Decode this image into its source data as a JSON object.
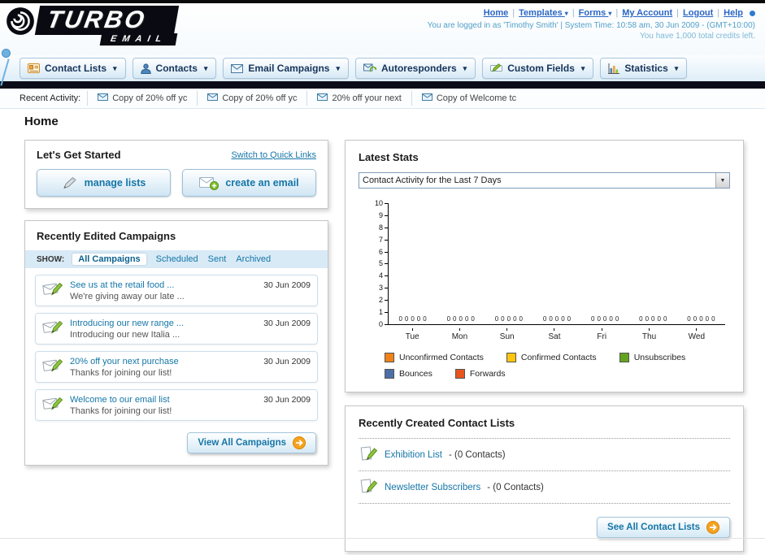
{
  "header": {
    "logo": {
      "line1": "TURBO",
      "line2": "EMAIL"
    },
    "nav_links": [
      {
        "label": "Home",
        "dropdown": false
      },
      {
        "label": "Templates",
        "dropdown": true
      },
      {
        "label": "Forms",
        "dropdown": true
      },
      {
        "label": "My Account",
        "dropdown": false
      },
      {
        "label": "Logout",
        "dropdown": false
      },
      {
        "label": "Help",
        "dropdown": false
      }
    ],
    "login_info": "You are logged in as 'Timothy Smith' | System Time: 10:58 am, 30 Jun 2009 - (GMT+10:00)",
    "credits_info": "You have 1,000 total credits left."
  },
  "main_nav": {
    "tabs": [
      {
        "label": "Contact Lists",
        "icon": "contact-lists-icon"
      },
      {
        "label": "Contacts",
        "icon": "contacts-icon"
      },
      {
        "label": "Email Campaigns",
        "icon": "email-campaigns-icon"
      },
      {
        "label": "Autoresponders",
        "icon": "autoresponders-icon"
      },
      {
        "label": "Custom Fields",
        "icon": "custom-fields-icon"
      },
      {
        "label": "Statistics",
        "icon": "statistics-icon"
      }
    ]
  },
  "recent_activity": {
    "label": "Recent Activity:",
    "items": [
      "Copy of 20% off yc",
      "Copy of 20% off yc",
      "20% off your next",
      "Copy of Welcome tc"
    ]
  },
  "page_title": "Home",
  "get_started": {
    "title": "Let's Get Started",
    "switch_link": "Switch to Quick Links",
    "buttons": [
      {
        "label": "manage lists"
      },
      {
        "label": "create an email"
      }
    ]
  },
  "campaigns": {
    "title": "Recently Edited Campaigns",
    "show_label": "SHOW:",
    "filters": [
      "All Campaigns",
      "Scheduled",
      "Sent",
      "Archived"
    ],
    "active_filter": "All Campaigns",
    "items": [
      {
        "title": "See us at the retail food ...",
        "subtitle": "We're giving away our late ...",
        "date": "30 Jun 2009"
      },
      {
        "title": "Introducing our new range ...",
        "subtitle": "Introducing our new Italia ...",
        "date": "30 Jun 2009"
      },
      {
        "title": "20% off your next purchase",
        "subtitle": "Thanks for joining our list!",
        "date": "30 Jun 2009"
      },
      {
        "title": "Welcome to our email list",
        "subtitle": "Thanks for joining our list!",
        "date": "30 Jun 2009"
      }
    ],
    "view_all_label": "View All Campaigns"
  },
  "latest_stats": {
    "title": "Latest Stats",
    "dropdown_value": "Contact Activity for the Last 7 Days",
    "legend": [
      {
        "label": "Unconfirmed Contacts",
        "color": "#f08219"
      },
      {
        "label": "Confirmed Contacts",
        "color": "#ffc40d"
      },
      {
        "label": "Unsubscribes",
        "color": "#63a41e"
      },
      {
        "label": "Bounces",
        "color": "#4d6fa8"
      },
      {
        "label": "Forwards",
        "color": "#e8541d"
      }
    ]
  },
  "chart_data": {
    "type": "bar",
    "title": "Contact Activity for the Last 7 Days",
    "categories": [
      "Tue",
      "Mon",
      "Sun",
      "Sat",
      "Fri",
      "Thu",
      "Wed"
    ],
    "series": [
      {
        "name": "Unconfirmed Contacts",
        "color": "#f08219",
        "values": [
          0,
          0,
          0,
          0,
          0,
          0,
          0
        ]
      },
      {
        "name": "Confirmed Contacts",
        "color": "#ffc40d",
        "values": [
          0,
          0,
          0,
          0,
          0,
          0,
          0
        ]
      },
      {
        "name": "Unsubscribes",
        "color": "#63a41e",
        "values": [
          0,
          0,
          0,
          0,
          0,
          0,
          0
        ]
      },
      {
        "name": "Bounces",
        "color": "#4d6fa8",
        "values": [
          0,
          0,
          0,
          0,
          0,
          0,
          0
        ]
      },
      {
        "name": "Forwards",
        "color": "#e8541d",
        "values": [
          0,
          0,
          0,
          0,
          0,
          0,
          0
        ]
      }
    ],
    "ylim": [
      0,
      10
    ],
    "yticks": [
      0,
      1,
      2,
      3,
      4,
      5,
      6,
      7,
      8,
      9,
      10
    ],
    "value_labels_shown": true,
    "grid": false,
    "legend_position": "bottom"
  },
  "contact_lists": {
    "title": "Recently Created Contact Lists",
    "items": [
      {
        "name": "Exhibition List",
        "suffix": "- (0 Contacts)"
      },
      {
        "name": "Newsletter Subscribers",
        "suffix": "- (0 Contacts)"
      }
    ],
    "see_all_label": "See All Contact Lists"
  }
}
